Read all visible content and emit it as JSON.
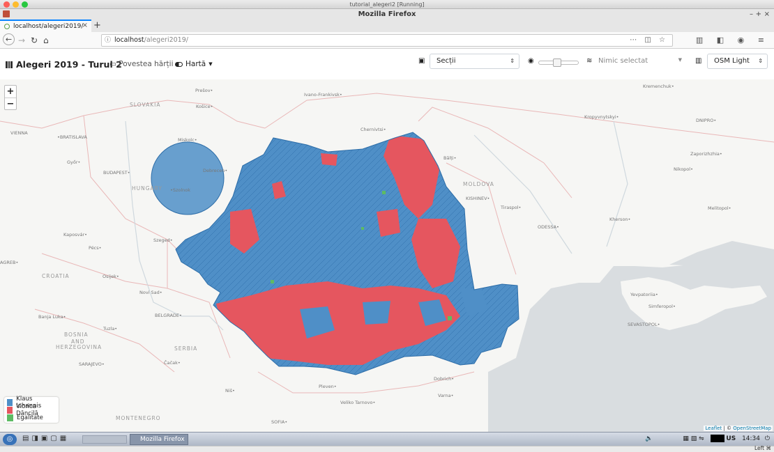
{
  "vm_window": {
    "title": "tutorial_alegeri2 [Running]"
  },
  "browser": {
    "window_title": "Mozilla Firefox",
    "tab": {
      "label": "localhost/alegeri2019/"
    },
    "url": {
      "host": "localhost",
      "path": "/alegeri2019/"
    }
  },
  "app": {
    "title": "Alegeri 2019 - Turul 2",
    "menu_story": "Povestea hărții",
    "menu_map": "Hartă",
    "granularity_select": {
      "value": "Secții"
    },
    "overlay_select": {
      "value": "Nimic selectat"
    },
    "opacity_slider": {
      "fraction": 0.45
    },
    "basemap_select": {
      "value": "OSM Light"
    }
  },
  "map": {
    "zoom_in": "+",
    "zoom_out": "−",
    "legend": [
      {
        "label": "Klaus Iohannis",
        "color": "#4f8fc7"
      },
      {
        "label": "Viorica Dăncilă",
        "color": "#e5565f"
      },
      {
        "label": "Egalitate",
        "color": "#5dbb63"
      }
    ],
    "attribution_leaflet": "Leaflet",
    "attribution_sep": " | © ",
    "attribution_osm": "OpenStreetMap",
    "labels": {
      "slovakia": "SLOVAKIA",
      "hungary": "HUNGARY",
      "moldova": "MOLDOVA",
      "croatia": "CROATIA",
      "bosnia": "BOSNIA",
      "and": "AND",
      "herzegovina": "HERZEGOVINA",
      "serbia": "SERBIA",
      "montenegro": "MONTENEGRO",
      "vienna": "VIENNA",
      "bratislava": "•BRATISLAVA",
      "budapest": "BUDAPEST•",
      "presov": "Prešov•",
      "kosice": "Košice•",
      "miskolc": "Miskolc•",
      "debrecen": "Debrecen•",
      "szolnok": "•Szolnok",
      "gyor": "Győr•",
      "ivano": "Ivano-Frankivsk•",
      "chernivtsi": "Chernivtsi•",
      "balti": "Bălți•",
      "kishinev": "KISHINEV•",
      "tiraspol": "Tiraspol•",
      "odessa": "ODESSA•",
      "kherson": "Kherson•",
      "melitopol": "Melitopol•",
      "kremenchuk": "Kremenchuk•",
      "kropyvnytskyi": "Kropyvnytskyi•",
      "dnipro": "DNIPRO•",
      "zaporizhzhia": "Zaporizhzhia•",
      "nikopol": "Nikopol•",
      "kaposvar": "Kaposvár•",
      "pecs": "Pécs•",
      "szeged": "Szeged•",
      "osijek": "Osijek•",
      "novisad": "Novi Sad•",
      "belgrade": "BELGRADE•",
      "banjaluka": "Banja Luka•",
      "tuzla": "Tuzla•",
      "sarajevo": "SARAJEVO•",
      "cacak": "Čačak•",
      "nis": "Niš•",
      "pleven": "Pleven•",
      "veliko": "Veliko Tarnovo•",
      "dobrich": "Dobrich•",
      "varna": "Varna•",
      "sofia": "SOFIA•",
      "yevpatoriia": "Yevpatoriia•",
      "simferopol": "Simferopol•",
      "sevastopol": "SEVASTOPOL•",
      "zagreb": "AGREB•"
    }
  },
  "taskbar": {
    "task_label": "Mozilla Firefox",
    "keyboard": "US",
    "clock": "14:34"
  },
  "statusbar": {
    "host_key": "Left ⌘"
  }
}
